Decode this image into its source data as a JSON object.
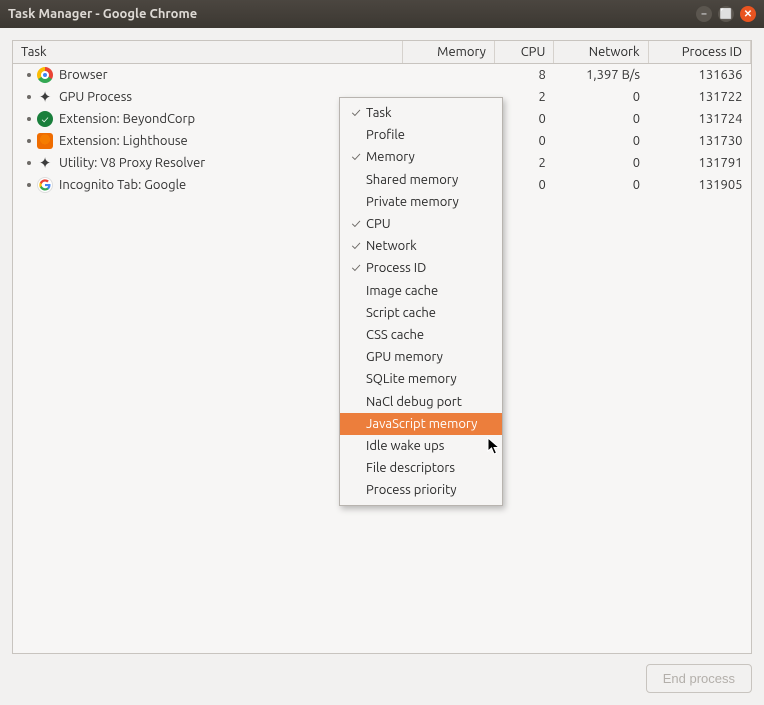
{
  "window": {
    "title": "Task Manager - Google Chrome"
  },
  "columns": {
    "task": "Task",
    "memory": "Memory",
    "cpu": "CPU",
    "network": "Network",
    "process_id": "Process ID"
  },
  "rows": [
    {
      "icon": "chrome",
      "name": "Browser",
      "cpu": "8",
      "network": "1,397 B/s",
      "pid": "131636"
    },
    {
      "icon": "puzzle",
      "name": "GPU Process",
      "cpu": "2",
      "network": "0",
      "pid": "131722"
    },
    {
      "icon": "beyondcorp",
      "name": "Extension: BeyondCorp",
      "cpu": "0",
      "network": "0",
      "pid": "131724"
    },
    {
      "icon": "lighthouse",
      "name": "Extension: Lighthouse",
      "cpu": "0",
      "network": "0",
      "pid": "131730"
    },
    {
      "icon": "puzzle",
      "name": "Utility: V8 Proxy Resolver",
      "cpu": "2",
      "network": "0",
      "pid": "131791"
    },
    {
      "icon": "google",
      "name": "Incognito Tab: Google",
      "cpu": "0",
      "network": "0",
      "pid": "131905"
    }
  ],
  "context_menu": {
    "hovered_index": 14,
    "items": [
      {
        "label": "Task",
        "checked": true
      },
      {
        "label": "Profile",
        "checked": false
      },
      {
        "label": "Memory",
        "checked": true
      },
      {
        "label": "Shared memory",
        "checked": false
      },
      {
        "label": "Private memory",
        "checked": false
      },
      {
        "label": "CPU",
        "checked": true
      },
      {
        "label": "Network",
        "checked": true
      },
      {
        "label": "Process ID",
        "checked": true
      },
      {
        "label": "Image cache",
        "checked": false
      },
      {
        "label": "Script cache",
        "checked": false
      },
      {
        "label": "CSS cache",
        "checked": false
      },
      {
        "label": "GPU memory",
        "checked": false
      },
      {
        "label": "SQLite memory",
        "checked": false
      },
      {
        "label": "NaCl debug port",
        "checked": false
      },
      {
        "label": "JavaScript memory",
        "checked": false
      },
      {
        "label": "Idle wake ups",
        "checked": false
      },
      {
        "label": "File descriptors",
        "checked": false
      },
      {
        "label": "Process priority",
        "checked": false
      }
    ]
  },
  "footer": {
    "end_process": "End process"
  }
}
